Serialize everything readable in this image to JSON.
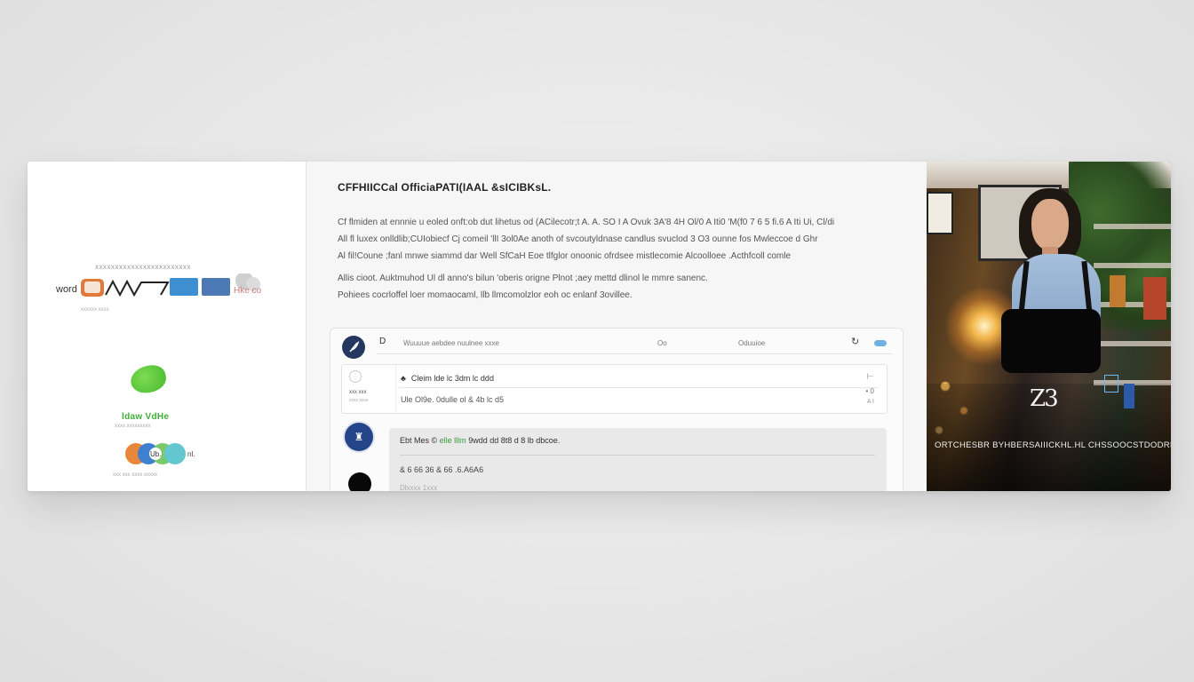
{
  "left_panel": {
    "logo_caption": "xxxxxxxxxxxxxxxxxxxxxxxx",
    "logo_prefix": "word",
    "logo_suffix": "Hke co",
    "logo_sub": "xxxxxx xxxx",
    "green_text": "ldaw VdHe",
    "green_sub": "xxxx xxxxxxxxx",
    "circles_label": "Ub.",
    "circles_suffix": "nl.",
    "circles_cap": "xxx xxx xxxx xxxxx"
  },
  "main": {
    "title": "CFFHIICCal OfficiaPATI(IAAL &sICIBKsL.",
    "paragraph1": [
      "Cf flmiden at ennnie u eoled onft:ob dut lihetus od  (ACilecotr;t A.  A.  SO I A Ovuk 3A'8 4H Ol/0 A Iti0 'M(f0 7 6 5 fi.6  A Iti Ui, Cl/di",
      "All fl luxex onlldlib;CUIobiecf Cj comeil 'llI 3ol0Ae anoth of svcoutyldnase candlus svuclod 3 O3 ounne fos Mwleccoe d Ghr",
      "Al fil!Coune ;fanl mnwe siammd dar Well SfCaH Eoe tlfglor onoonic ofrdsee mistlecomie Alcoolloee .Acthfcoll comle"
    ],
    "paragraph2": [
      "Allis cioot. Auktmuhod Ul dl anno's bilun 'oberis origne Plnot ;aey mettd dlinol le mmre sanenc.",
      "Pohiees cocrloffel loer momaocaml, llb llmcomolzlor eoh oc enlanf 3ovillee."
    ],
    "toolbar": {
      "left_glyph": "D",
      "search_placeholder": "Wuuuue aebdee nuulnee  xxxe",
      "on_label": "Oo",
      "option_label": "Oduuioe"
    },
    "row": {
      "line1_icon": "♣",
      "line1": "Cleim  lde lc 3dm lc ddd",
      "line2": "Ule Ol9e. 0dulle  ol & 4b lc d5",
      "thumb1": "xxx xxx",
      "thumb2": "xxxx xxxx",
      "r2": "• 0",
      "r3": "A I"
    },
    "message": {
      "line1_prefix": "Ebt  Mes  ©",
      "line1_highlight": "elle  lllm",
      "line1_suffix": "9wdd dd 8t8  d 8 lb dbcoe.",
      "line2": "& 6 66 36 & 66 .6.A6A6",
      "line3": "Dlxxxx  1xxx"
    }
  },
  "photo": {
    "badge": "Z3",
    "caption": "ORTCHESBR  BYHBERSAIIICKHL.HL CHSSOOCSTDODRIC"
  },
  "colors": {
    "accent_dark": "#24375e",
    "avatar_blue": "#25458a",
    "highlight_green": "#3c9a3c",
    "toggle_blue": "#6fb0e0"
  }
}
